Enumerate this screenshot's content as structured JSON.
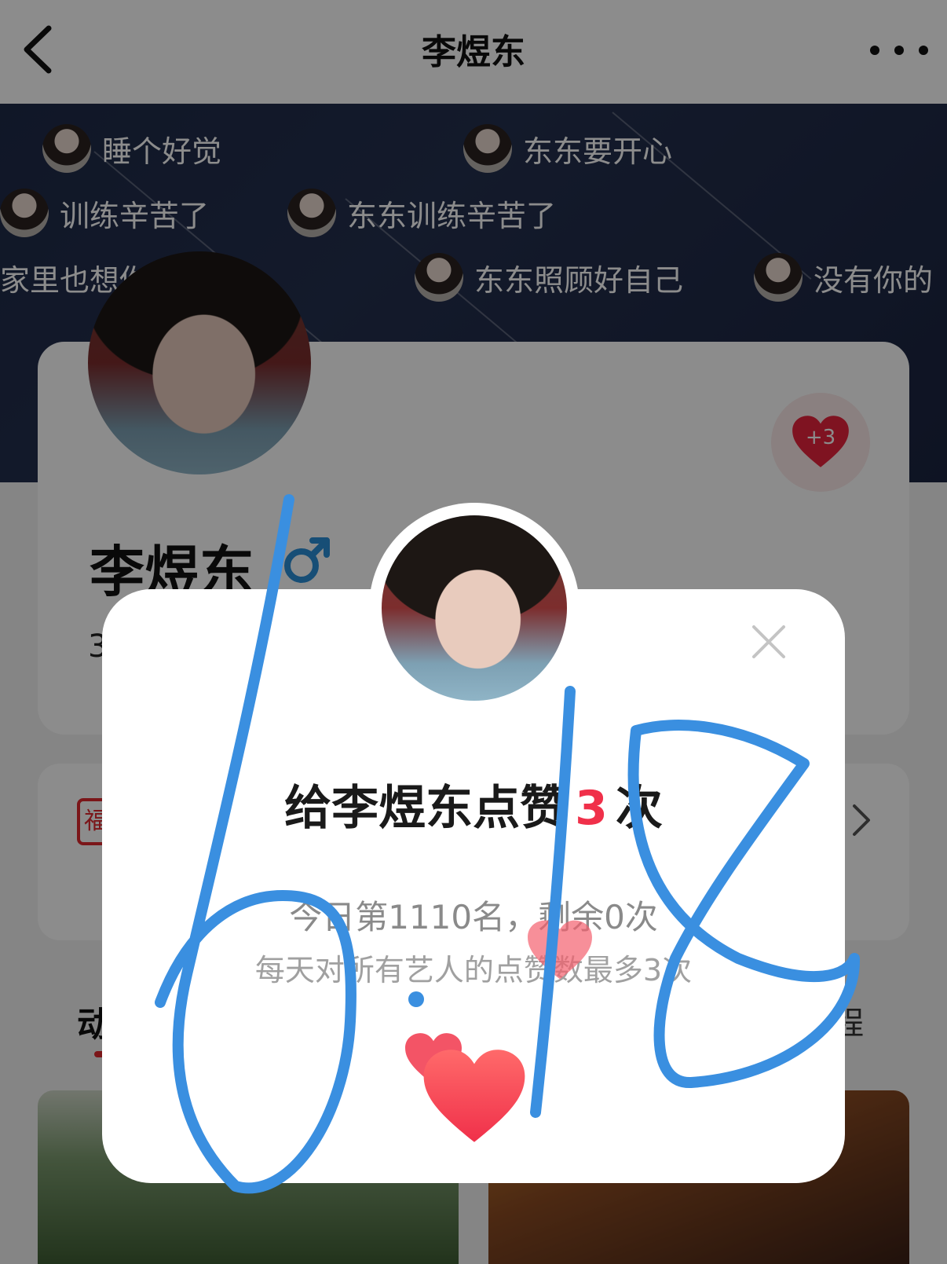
{
  "nav": {
    "title": "李煜东"
  },
  "danmu": [
    "睡个好觉",
    "东东要开心",
    "训练辛苦了",
    "东东训练辛苦了",
    "家里也想你",
    "东东照顾好自己",
    "没有你的"
  ],
  "profile": {
    "name": "李煜东",
    "like_plus": "+3",
    "stat_peek": "3"
  },
  "info": {
    "tag_peek": "福"
  },
  "tabs": {
    "left": "动",
    "right": "程"
  },
  "modal": {
    "title_prefix": "给李煜东点赞",
    "count": "3",
    "title_suffix": "次",
    "rank": "今日第1110名，剩余0次",
    "limit": "每天对所有艺人的点赞数最多3次"
  },
  "handwriting": "6:18",
  "colors": {
    "accent": "#f0304a",
    "brand_red": "#e0282e",
    "male_blue": "#2b8fd8",
    "pen_blue": "#3a8fe0"
  }
}
